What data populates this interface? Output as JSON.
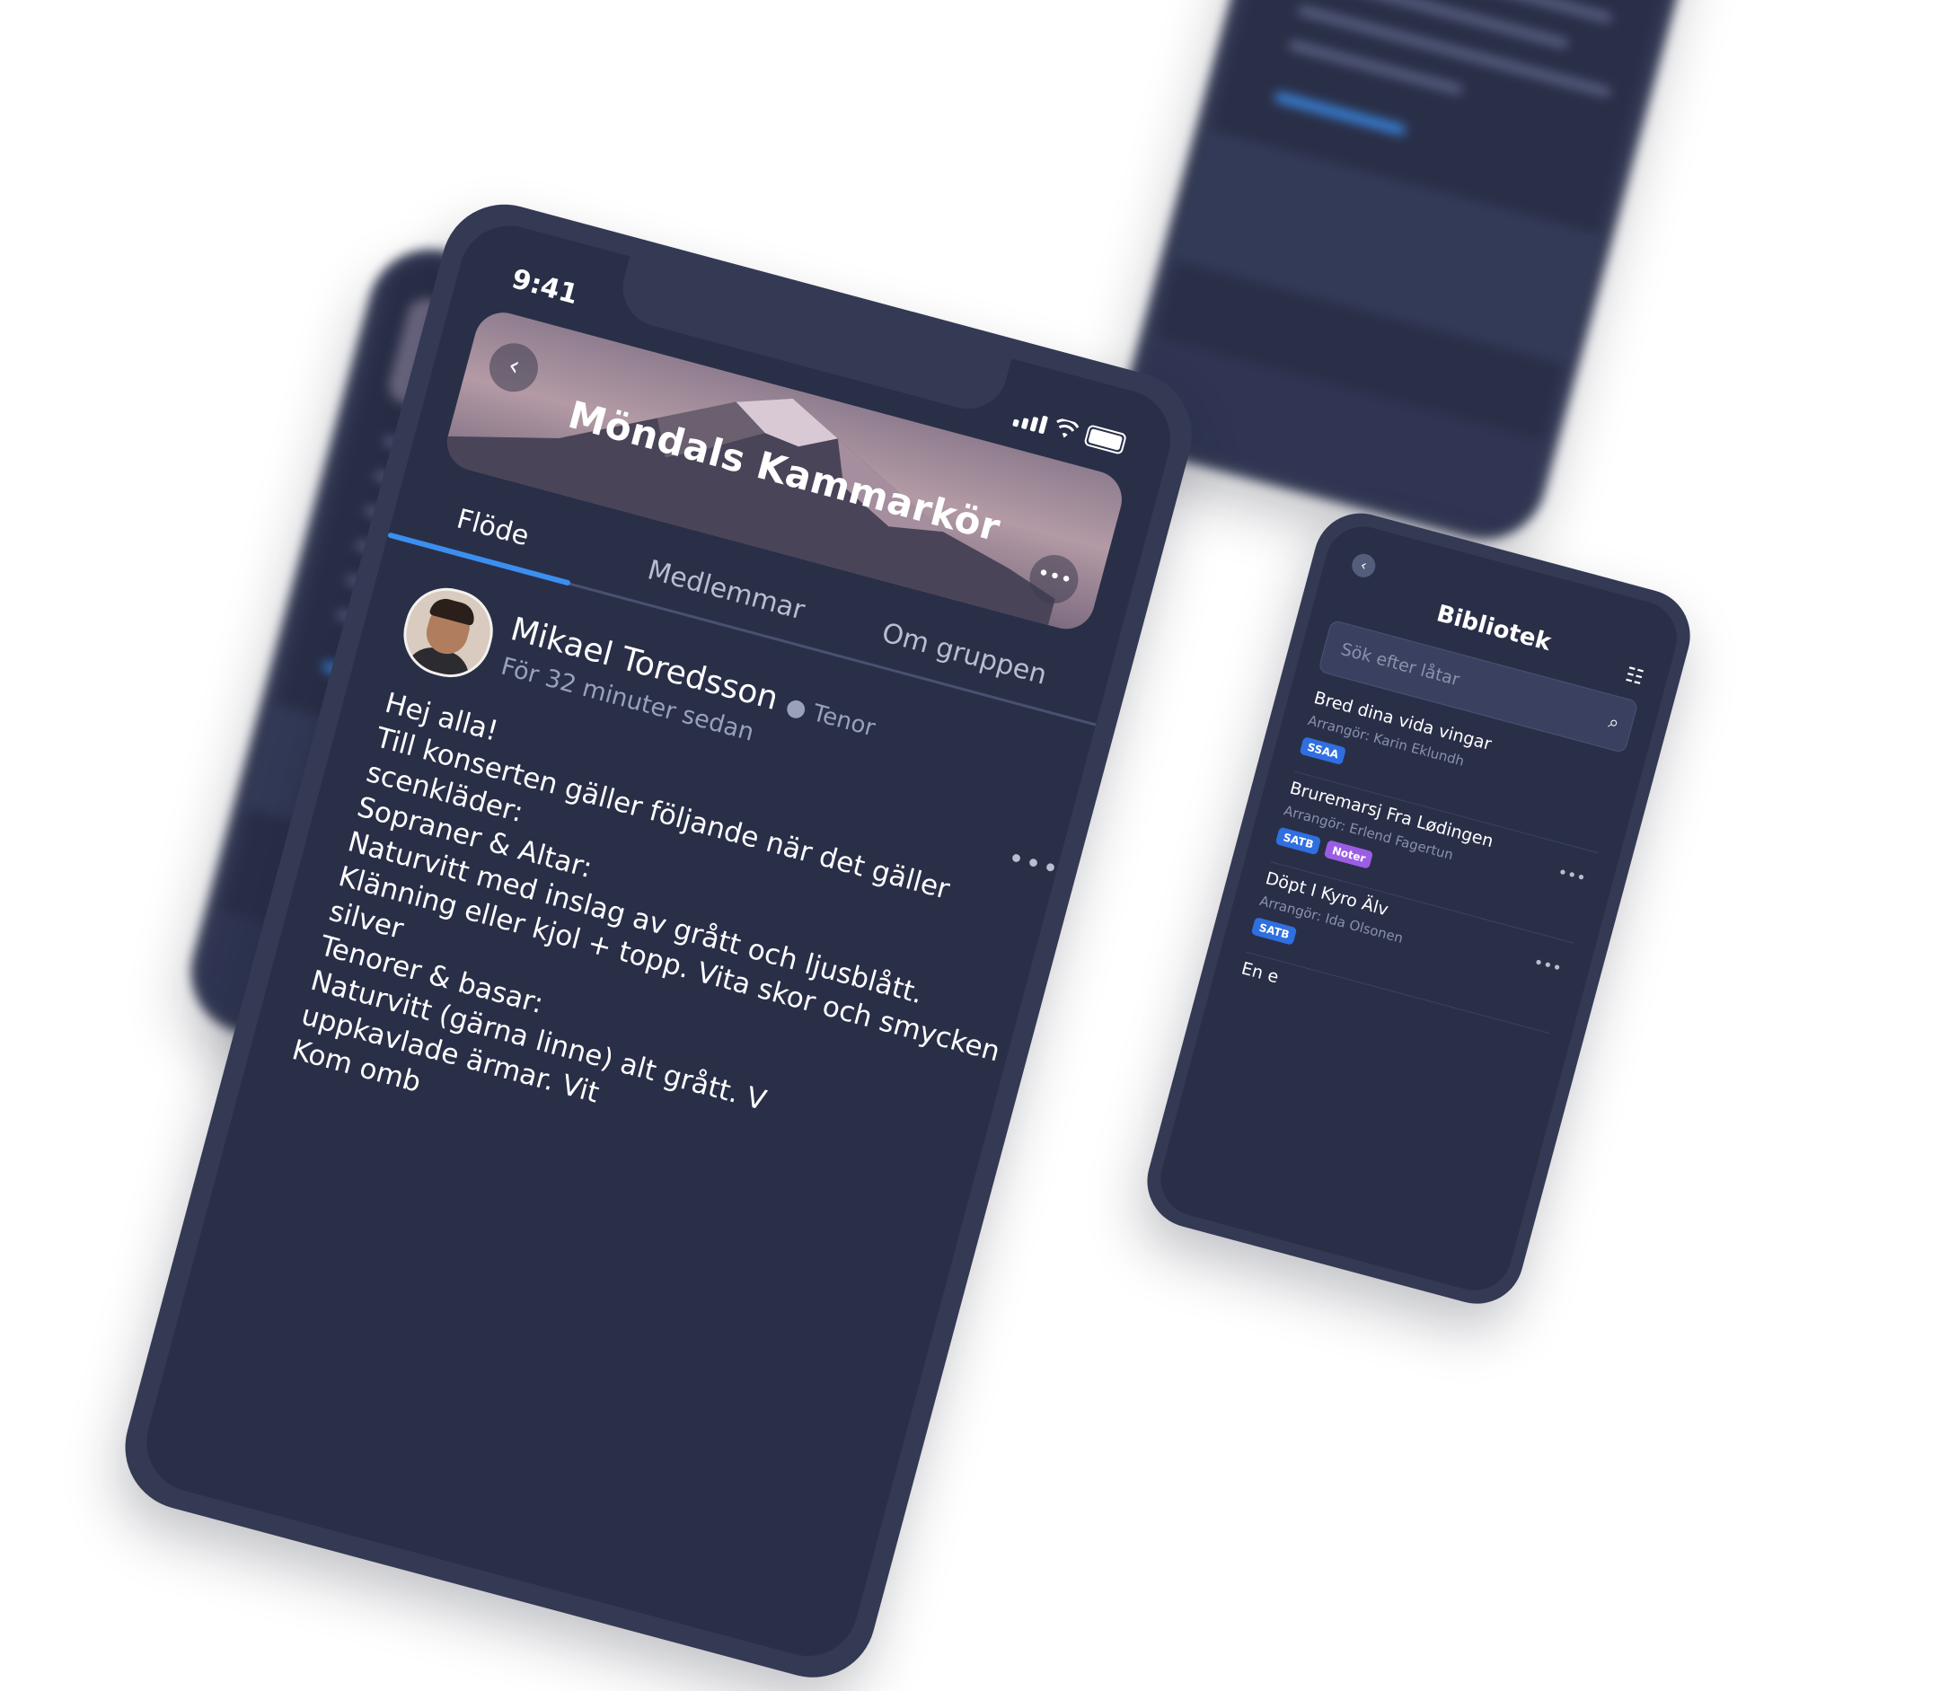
{
  "main": {
    "status_time": "9:41",
    "group_title": "Möndals Kammarkör",
    "tabs": [
      {
        "label": "Flöde",
        "active": true
      },
      {
        "label": "Medlemmar",
        "active": false
      },
      {
        "label": "Om gruppen",
        "active": false
      }
    ],
    "post": {
      "author": "Mikael Toredsson",
      "role": "● Tenor",
      "time": "För 32 minuter sedan",
      "lines": [
        "Hej alla!",
        "Till konserten gäller följande när det gäller",
        "scenkläder:",
        "Sopraner & Altar:",
        "Naturvitt med inslag av grått och ljusblått.",
        "Klänning eller kjol + topp. Vita skor och smycken i",
        "silver",
        "Tenorer & basar:",
        "Naturvitt (gärna linne) alt grått. V",
        "uppkavlade ärmar. Vit",
        "Kom omb"
      ],
      "more_icon": "ellipsis-icon"
    },
    "icons": {
      "back": "chevron-left-icon",
      "menu": "ellipsis-icon",
      "signal": "signal-icon",
      "wifi": "wifi-icon",
      "battery": "battery-icon"
    },
    "accent": "#3b8ff0"
  },
  "library": {
    "title": "Bibliotek",
    "search_placeholder": "Sök efter låtar",
    "songs": [
      {
        "title": "Bred dina vida vingar",
        "arranger": "Arrangör: Karin Eklundh",
        "tags": [
          {
            "label": "SSAA",
            "color": "#2f6fe0"
          }
        ]
      },
      {
        "title": "Bruremarsj Fra Lødingen",
        "arranger": "Arrangör: Erlend Fagertun",
        "tags": [
          {
            "label": "SATB",
            "color": "#2f6fe0"
          },
          {
            "label": "Noter",
            "color": "#9b5de5"
          }
        ]
      },
      {
        "title": "Döpt I Kyro Älv",
        "arranger": "Arrangör: Ida Olsonen",
        "tags": [
          {
            "label": "SATB",
            "color": "#2f6fe0"
          }
        ]
      },
      {
        "title": "En e",
        "arranger": "",
        "tags": []
      }
    ],
    "more_label": "•••",
    "icons": {
      "back": "chevron-left-icon",
      "filter": "sliders-icon",
      "search": "search-icon"
    }
  }
}
